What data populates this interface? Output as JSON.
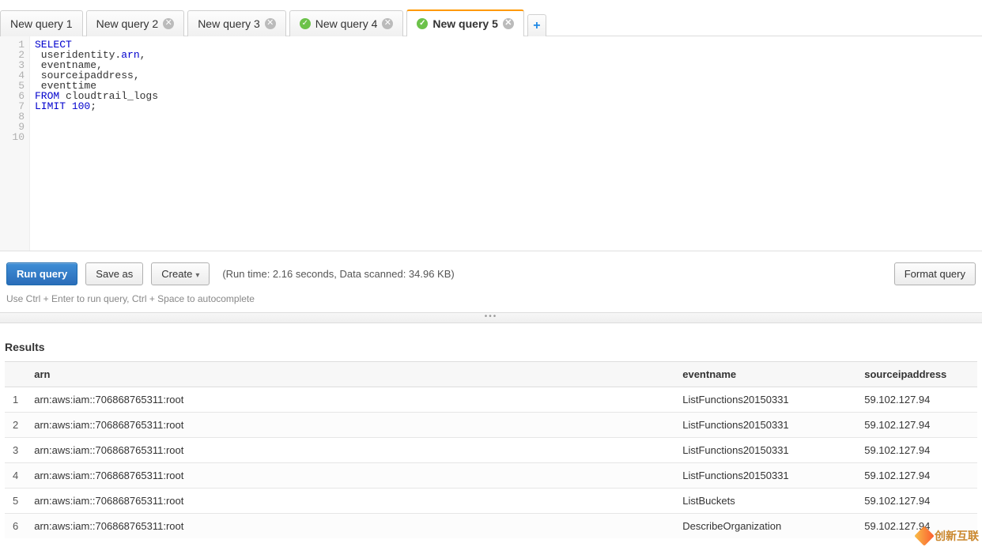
{
  "tabs": [
    {
      "label": "New query 1",
      "has_close": false,
      "has_status": false,
      "active": false
    },
    {
      "label": "New query 2",
      "has_close": true,
      "has_status": false,
      "active": false
    },
    {
      "label": "New query 3",
      "has_close": true,
      "has_status": false,
      "active": false
    },
    {
      "label": "New query 4",
      "has_close": true,
      "has_status": true,
      "active": false
    },
    {
      "label": "New query 5",
      "has_close": true,
      "has_status": true,
      "active": true
    }
  ],
  "editor": {
    "line_count": 10,
    "code_html": "<span class='kw'>SELECT</span>\n useridentity.<span class='ident-blue'>arn</span>,\n eventname,\n sourceipaddress,\n eventtime\n<span class='kw'>FROM</span> cloudtrail_logs\n<span class='kw'>LIMIT</span> <span class='num'>100</span>;\n\n\n"
  },
  "toolbar": {
    "run_label": "Run query",
    "save_as_label": "Save as",
    "create_label": "Create",
    "format_label": "Format query",
    "run_info": "(Run time: 2.16 seconds, Data scanned: 34.96 KB)",
    "hint": "Use Ctrl + Enter to run query, Ctrl + Space to autocomplete"
  },
  "results": {
    "title": "Results",
    "columns": [
      "",
      "arn",
      "eventname",
      "sourceipaddress"
    ],
    "rows": [
      {
        "idx": "1",
        "arn": "arn:aws:iam::706868765311:root",
        "eventname": "ListFunctions20150331",
        "sourceipaddress": "59.102.127.94"
      },
      {
        "idx": "2",
        "arn": "arn:aws:iam::706868765311:root",
        "eventname": "ListFunctions20150331",
        "sourceipaddress": "59.102.127.94"
      },
      {
        "idx": "3",
        "arn": "arn:aws:iam::706868765311:root",
        "eventname": "ListFunctions20150331",
        "sourceipaddress": "59.102.127.94"
      },
      {
        "idx": "4",
        "arn": "arn:aws:iam::706868765311:root",
        "eventname": "ListFunctions20150331",
        "sourceipaddress": "59.102.127.94"
      },
      {
        "idx": "5",
        "arn": "arn:aws:iam::706868765311:root",
        "eventname": "ListBuckets",
        "sourceipaddress": "59.102.127.94"
      },
      {
        "idx": "6",
        "arn": "arn:aws:iam::706868765311:root",
        "eventname": "DescribeOrganization",
        "sourceipaddress": "59.102.127.94"
      }
    ]
  },
  "watermark": "创新互联"
}
